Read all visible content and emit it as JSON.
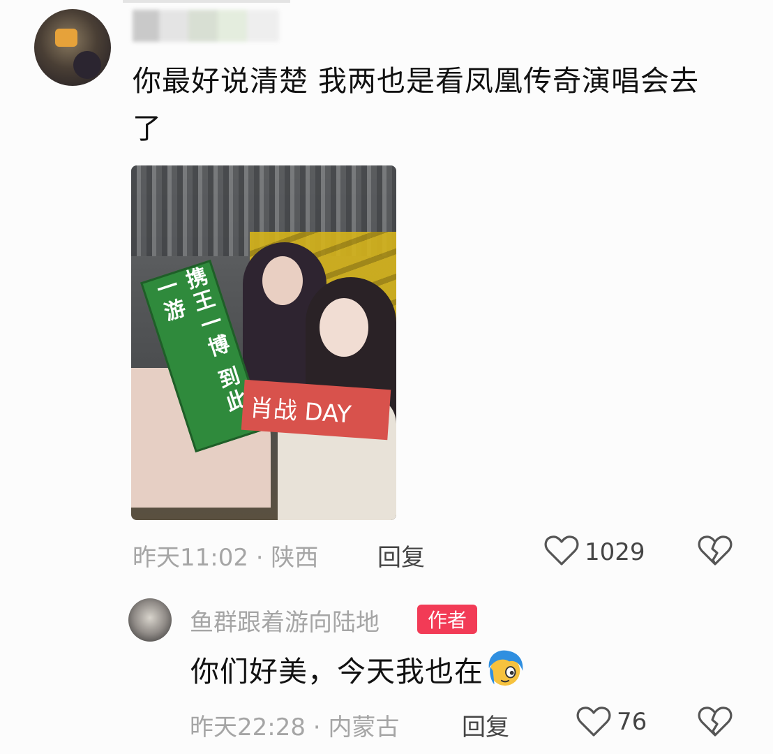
{
  "comment": {
    "text": "你最好说清楚 我两也是看凤凰传奇演唱会去了",
    "time": "昨天11:02",
    "location": "陕西",
    "reply_label": "回复",
    "like_count": "1029",
    "icons": {
      "like": "heart-outline-icon",
      "dislike": "broken-heart-icon"
    }
  },
  "photo": {
    "banner_green_text": "携王一博 到此一游",
    "banner_red_text": "肖战 DAY"
  },
  "reply": {
    "author": "鱼群跟着游向陆地",
    "badge": "作者",
    "text": "你们好美，今天我也在",
    "emoji": "blue-hair-face-emoji",
    "time": "昨天22:28",
    "location": "内蒙古",
    "reply_label": "回复",
    "like_count": "76"
  },
  "colors": {
    "badge": "#f23b56",
    "meta": "#a5a5a5"
  }
}
